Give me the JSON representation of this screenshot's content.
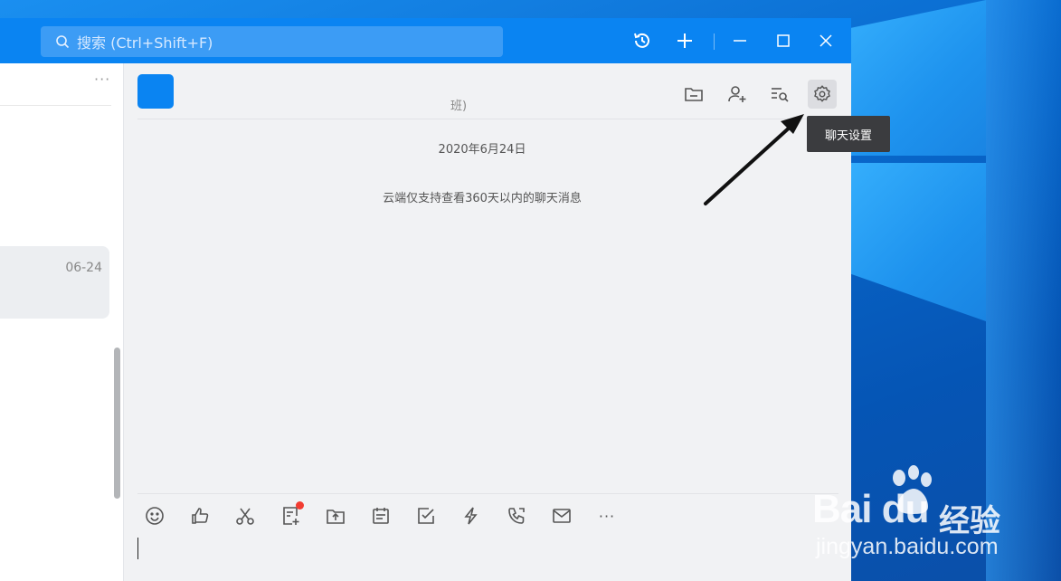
{
  "search": {
    "placeholder": "搜索 (Ctrl+Shift+F)"
  },
  "titlebar_buttons": [
    "history-icon",
    "plus-icon",
    "minimize-icon",
    "maximize-icon",
    "close-icon"
  ],
  "left_panel": {
    "more": "···",
    "conversation_date": "06-24"
  },
  "chat": {
    "name_fragment": "班)",
    "date_divider": "2020年6月24日",
    "notice": "云端仅支持查看360天以内的聊天消息",
    "tooltip": "聊天设置"
  },
  "header_actions": [
    "folder-icon",
    "add-member-icon",
    "search-history-icon",
    "gear-icon"
  ],
  "toolbar": [
    "emoji-icon",
    "thumbs-up-icon",
    "scissors-icon",
    "doc-add-icon",
    "upload-folder-icon",
    "calendar-icon",
    "checkbox-icon",
    "lightning-icon",
    "phone-icon",
    "mail-icon",
    "more-icon"
  ],
  "toolbar_more": "···",
  "watermark": {
    "logo": "Bai du",
    "cn": "经验",
    "url": "jingyan.baidu.com"
  },
  "colors": {
    "title_bar": "#0a84f2",
    "avatar": "#0a84f2",
    "tooltip_bg": "#3b3c3f",
    "badge": "#f23c31"
  }
}
